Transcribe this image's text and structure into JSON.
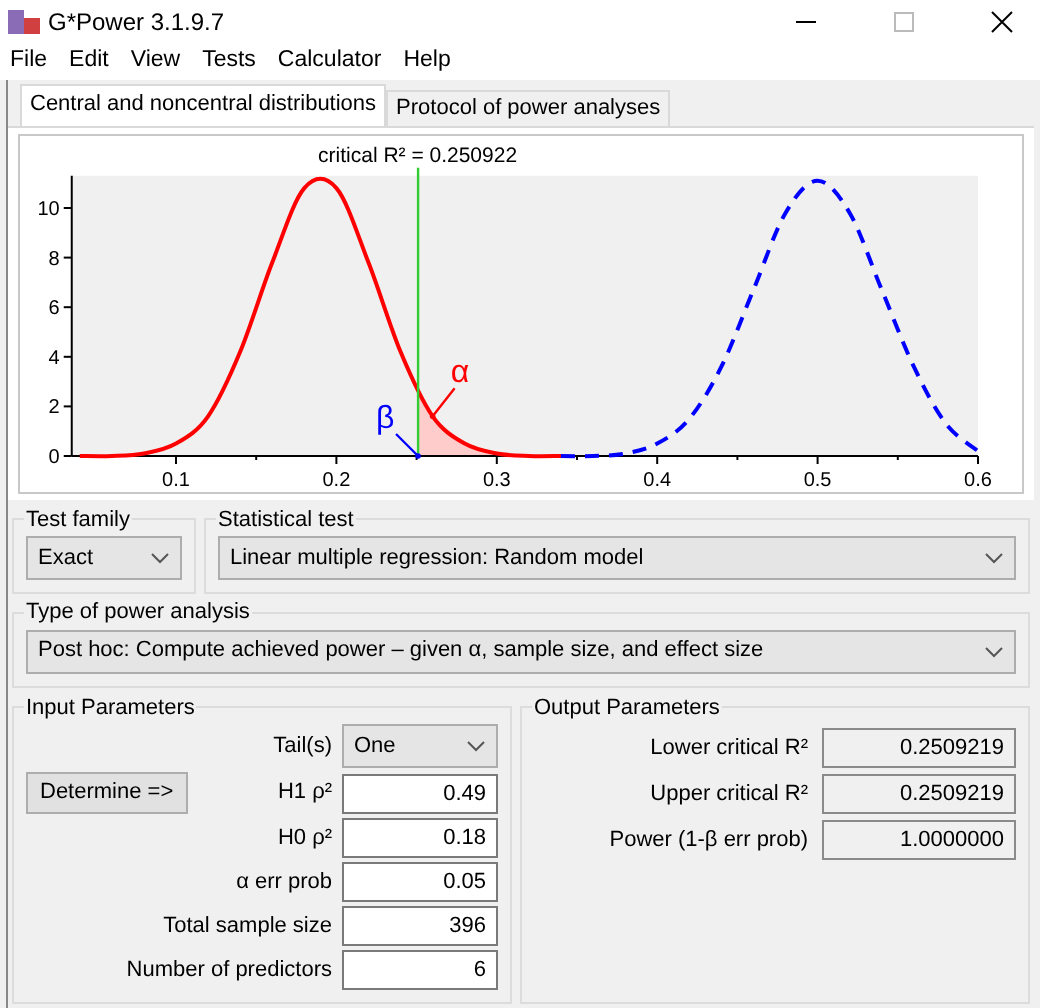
{
  "window": {
    "title": "G*Power 3.1.9.7"
  },
  "menu": [
    "File",
    "Edit",
    "View",
    "Tests",
    "Calculator",
    "Help"
  ],
  "tabs": [
    {
      "label": "Central and noncentral distributions",
      "selected": true
    },
    {
      "label": "Protocol of power analyses",
      "selected": false
    }
  ],
  "distribution_plot": {
    "chart_data": {
      "type": "line",
      "x": [
        0.04,
        0.06,
        0.08,
        0.1,
        0.12,
        0.14,
        0.16,
        0.18,
        0.2,
        0.22,
        0.24,
        0.26,
        0.28,
        0.3,
        0.32,
        0.34,
        0.36,
        0.38,
        0.4,
        0.42,
        0.44,
        0.46,
        0.48,
        0.5,
        0.52,
        0.54,
        0.56,
        0.58,
        0.6
      ],
      "series": [
        {
          "color": "#ff0000",
          "line_style": "solid",
          "values": [
            0,
            0,
            0.1,
            0.5,
            1.6,
            4.2,
            7.8,
            10.8,
            10.8,
            7.8,
            4.2,
            1.6,
            0.5,
            0.1,
            0,
            0,
            null,
            null,
            null,
            null,
            null,
            null,
            null,
            null,
            null,
            null,
            null,
            null,
            null
          ]
        },
        {
          "color": "#0000ff",
          "line_style": "dashed",
          "values": [
            null,
            null,
            null,
            null,
            null,
            null,
            null,
            null,
            null,
            null,
            null,
            null,
            null,
            null,
            null,
            0,
            0,
            0.1,
            0.5,
            1.5,
            3.6,
            6.7,
            9.8,
            11.1,
            9.8,
            6.7,
            3.6,
            1.3,
            0.2
          ]
        }
      ],
      "xlim": [
        0.035,
        0.6
      ],
      "ylim": [
        0,
        11.3
      ],
      "xticks": [
        0.1,
        0.2,
        0.3,
        0.4,
        0.5,
        0.6
      ],
      "yticks": [
        0,
        2,
        4,
        6,
        8,
        10
      ],
      "ref_lines": [
        {
          "axis": "x",
          "value": 0.250922,
          "label": "critical R² = 0.250922",
          "color": "#33cc33"
        }
      ],
      "annotations": [
        {
          "text": "β",
          "x": 0.2509,
          "y": 0
        },
        {
          "text": "α",
          "x": 0.26,
          "y": 1.6
        }
      ]
    }
  },
  "test_family": {
    "label": "Test family",
    "value": "Exact"
  },
  "statistical_test": {
    "label": "Statistical test",
    "value": "Linear multiple regression: Random model"
  },
  "type_of_power_analysis": {
    "label": "Type of power analysis",
    "value": "Post hoc: Compute achieved power – given α, sample size, and effect size"
  },
  "input_parameters": {
    "label": "Input Parameters",
    "button": "Determine =>",
    "fields": [
      {
        "kind": "dropdown",
        "label": "Tail(s)",
        "value": "One"
      },
      {
        "kind": "input",
        "label": "H1 ρ²",
        "value": "0.49"
      },
      {
        "kind": "input",
        "label": "H0 ρ²",
        "value": "0.18"
      },
      {
        "kind": "input",
        "label": "α err prob",
        "value": "0.05"
      },
      {
        "kind": "input",
        "label": "Total sample size",
        "value": "396"
      },
      {
        "kind": "input",
        "label": "Number of predictors",
        "value": "6"
      }
    ]
  },
  "output_parameters": {
    "label": "Output Parameters",
    "fields": [
      {
        "label": "Lower critical R²",
        "value": "0.2509219"
      },
      {
        "label": "Upper critical R²",
        "value": "0.2509219"
      },
      {
        "label": "Power (1-β err prob)",
        "value": "1.0000000"
      }
    ]
  }
}
